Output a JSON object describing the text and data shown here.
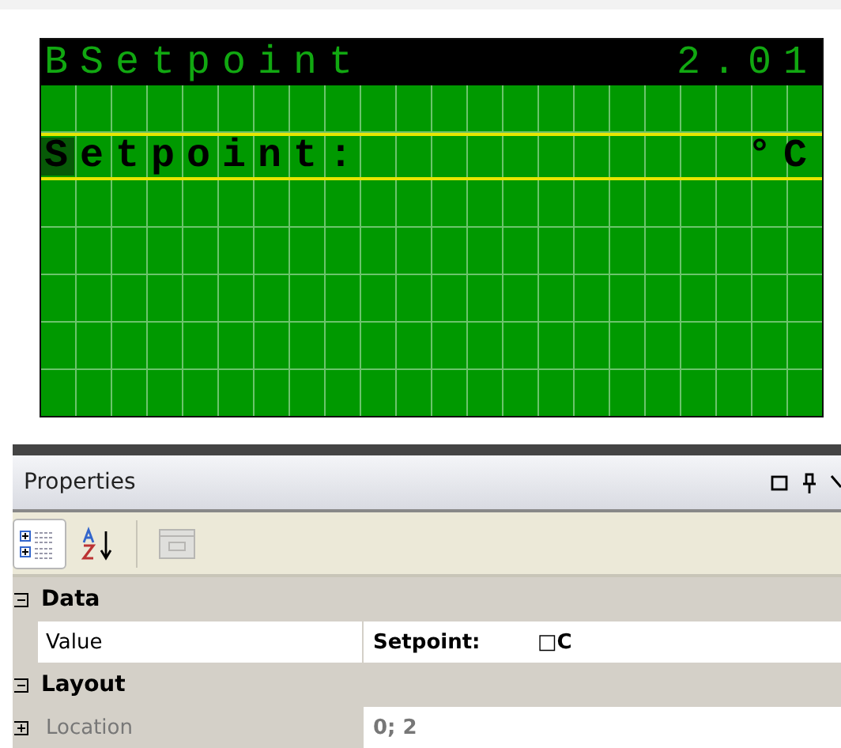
{
  "lcd": {
    "title": "BSetpoint",
    "version": "2.01",
    "lines": [
      {
        "text": "Setpoint:",
        "unit": "°C",
        "selected": true,
        "cursor": true
      }
    ]
  },
  "properties": {
    "title": "Properties",
    "window_buttons": [
      {
        "kind": "restore"
      },
      {
        "kind": "pin"
      },
      {
        "kind": "close"
      }
    ],
    "toolbar": [
      {
        "kind": "categorized",
        "selected": true,
        "disabled": false
      },
      {
        "kind": "alphabetical",
        "selected": false,
        "disabled": false
      },
      {
        "kind": "pages",
        "selected": false,
        "disabled": true
      }
    ],
    "categories": [
      {
        "name": "Data",
        "expanded": true,
        "properties": [
          {
            "name": "Value",
            "value": "Setpoint:        □C",
            "readonly": false
          }
        ]
      },
      {
        "name": "Layout",
        "expanded": true,
        "properties": [
          {
            "name": "Location",
            "value": "0; 2",
            "readonly": true,
            "expanded": false
          }
        ]
      }
    ]
  }
}
